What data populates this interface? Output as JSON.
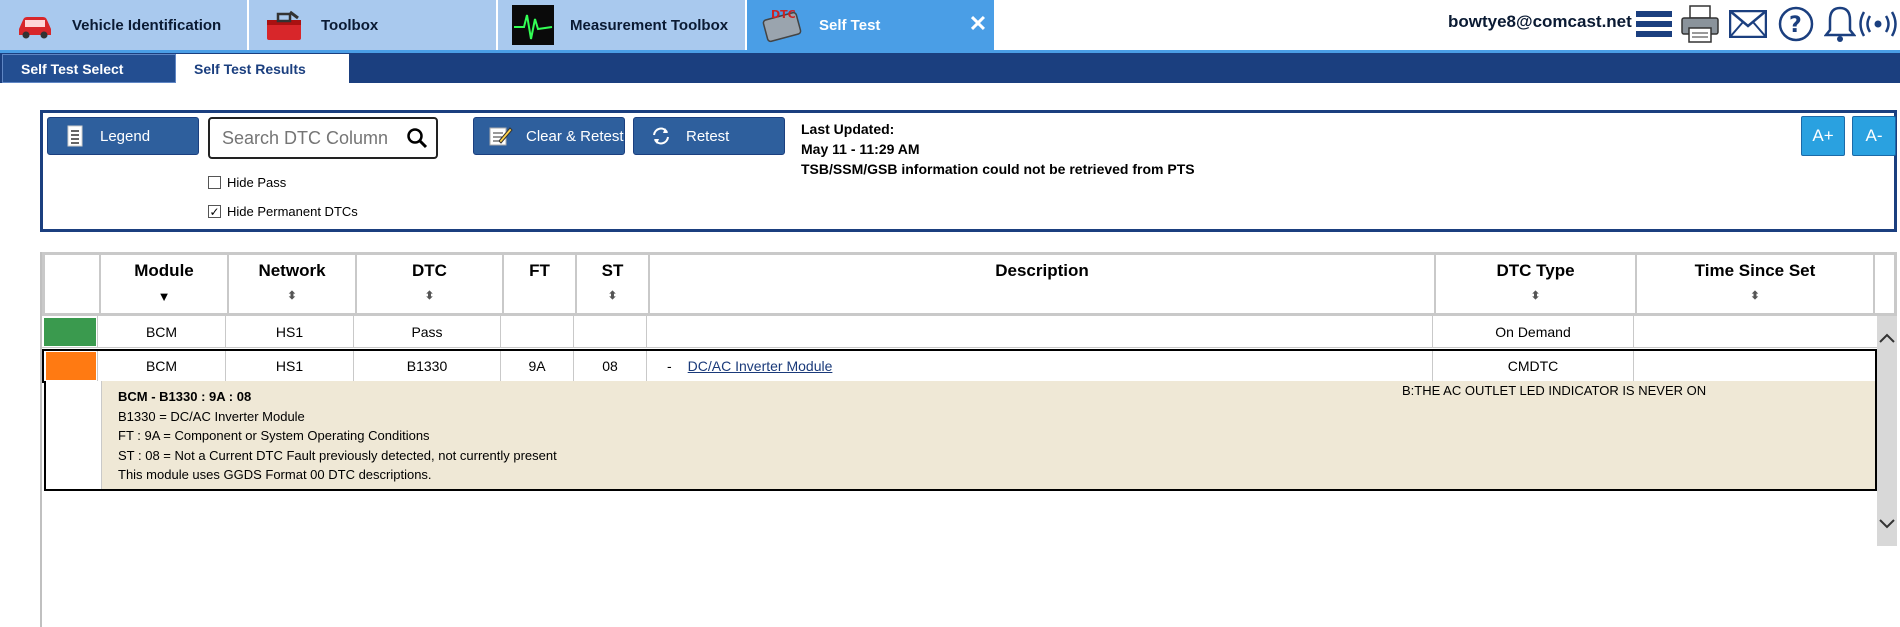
{
  "app_tabs": [
    {
      "label": "Vehicle Identification",
      "icon": "car-icon"
    },
    {
      "label": "Toolbox",
      "icon": "toolbox-icon"
    },
    {
      "label": "Measurement Toolbox",
      "icon": "oscilloscope-icon"
    },
    {
      "label": "Self Test",
      "icon": "dtc-icon"
    }
  ],
  "header": {
    "user_email": "bowtye8@comcast.net",
    "icons": [
      "menu-icon",
      "printer-icon",
      "mail-icon",
      "help-icon",
      "bell-icon",
      "wireless-icon"
    ]
  },
  "sub_tabs": [
    {
      "label": "Self Test Select"
    },
    {
      "label": "Self Test Results"
    }
  ],
  "toolbar": {
    "legend_label": "Legend",
    "search_placeholder": "Search DTC Column",
    "clear_retest_label": "Clear & Retest",
    "retest_label": "Retest",
    "hide_pass_label": "Hide Pass",
    "hide_pass_checked": false,
    "hide_permanent_label": "Hide Permanent DTCs",
    "hide_permanent_checked": true,
    "last_updated_label": "Last Updated:",
    "last_updated_value": "May 11 - 11:29 AM",
    "pts_message": "TSB/SSM/GSB information could not be retrieved from PTS",
    "font_increase_label": "A+",
    "font_decrease_label": "A-"
  },
  "table": {
    "columns": [
      "Module",
      "Network",
      "DTC",
      "FT",
      "ST",
      "Description",
      "DTC Type",
      "Time Since Set"
    ],
    "rows": [
      {
        "status_color": "#3a9a4e",
        "module": "BCM",
        "network": "HS1",
        "dtc": "Pass",
        "ft": "",
        "st": "",
        "description": "",
        "dtc_type": "On Demand",
        "time_since_set": ""
      },
      {
        "status_color": "#ff7a12",
        "module": "BCM",
        "network": "HS1",
        "dtc": "B1330",
        "ft": "9A",
        "st": "08",
        "description_prefix": "-",
        "description": "DC/AC Inverter Module",
        "dtc_type": "CMDTC",
        "time_since_set": ""
      }
    ],
    "detail": {
      "title": "BCM - B1330 : 9A : 08",
      "line1": "B1330 = DC/AC Inverter Module",
      "line2": "FT : 9A = Component or System Operating Conditions",
      "line3": "ST : 08 = Not a Current DTC Fault previously detected, not currently present",
      "line4": "This module uses GGDS Format 00 DTC descriptions.",
      "note": "B:THE AC OUTLET LED INDICATOR IS NEVER ON"
    }
  }
}
